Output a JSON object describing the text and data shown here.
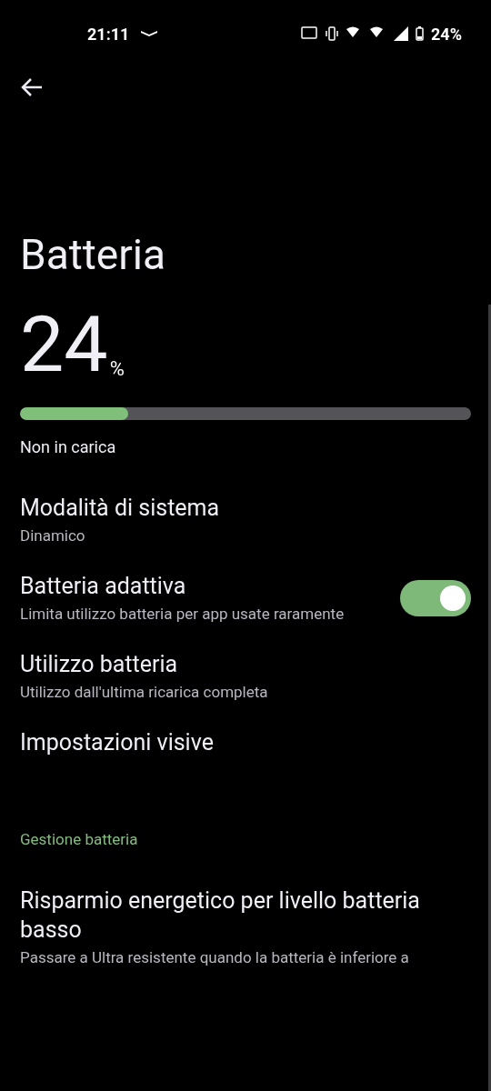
{
  "status_bar": {
    "time": "21:11",
    "battery_text": "24%"
  },
  "title": "Batteria",
  "battery": {
    "value": "24",
    "unit": "%",
    "level": 0.24,
    "status": "Non in carica"
  },
  "items": [
    {
      "kind": "plain",
      "title": "Modalità di sistema",
      "subtitle": "Dinamico"
    },
    {
      "kind": "toggle",
      "title": "Batteria adattiva",
      "subtitle": "Limita utilizzo batteria per app usate raramente",
      "on": true
    },
    {
      "kind": "plain",
      "title": "Utilizzo batteria",
      "subtitle": "Utilizzo dall'ultima ricarica completa"
    },
    {
      "kind": "plain",
      "title": "Impostazioni visive"
    }
  ],
  "section": {
    "header": "Gestione batteria",
    "items": [
      {
        "kind": "plain",
        "title": "Risparmio energetico per livello batteria basso",
        "subtitle": "Passare a Ultra resistente quando la batteria è inferiore a"
      }
    ]
  }
}
